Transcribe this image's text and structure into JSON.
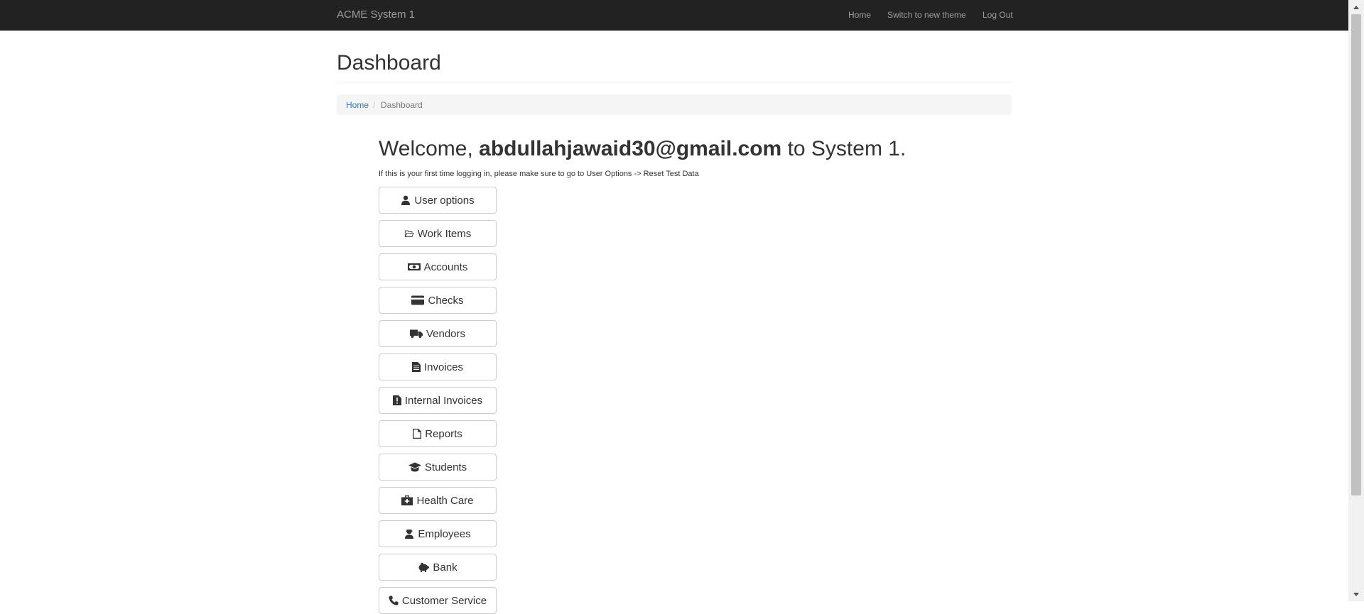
{
  "navbar": {
    "brand": "ACME System 1",
    "links": [
      {
        "label": "Home"
      },
      {
        "label": "Switch to new theme"
      },
      {
        "label": "Log Out"
      }
    ]
  },
  "page": {
    "title": "Dashboard",
    "breadcrumb": {
      "home": "Home",
      "separator": "/",
      "active": "Dashboard"
    }
  },
  "welcome": {
    "prefix": "Welcome,",
    "email": "abdullahjawaid30@gmail.com",
    "suffix": "to System 1.",
    "notice": "If this is your first time logging in, please make sure to go to User Options -> Reset Test Data"
  },
  "menu": [
    {
      "label": "User options",
      "icon": "user-icon"
    },
    {
      "label": "Work Items",
      "icon": "folder-open-icon"
    },
    {
      "label": "Accounts",
      "icon": "money-icon"
    },
    {
      "label": "Checks",
      "icon": "credit-card-icon"
    },
    {
      "label": "Vendors",
      "icon": "truck-icon"
    },
    {
      "label": "Invoices",
      "icon": "file-text-icon"
    },
    {
      "label": "Internal Invoices",
      "icon": "file-alert-icon"
    },
    {
      "label": "Reports",
      "icon": "file-outline-icon"
    },
    {
      "label": "Students",
      "icon": "graduation-cap-icon"
    },
    {
      "label": "Health Care",
      "icon": "medkit-icon"
    },
    {
      "label": "Employees",
      "icon": "user-employee-icon"
    },
    {
      "label": "Bank",
      "icon": "piggy-bank-icon"
    },
    {
      "label": "Customer Service",
      "icon": "phone-icon"
    }
  ]
}
